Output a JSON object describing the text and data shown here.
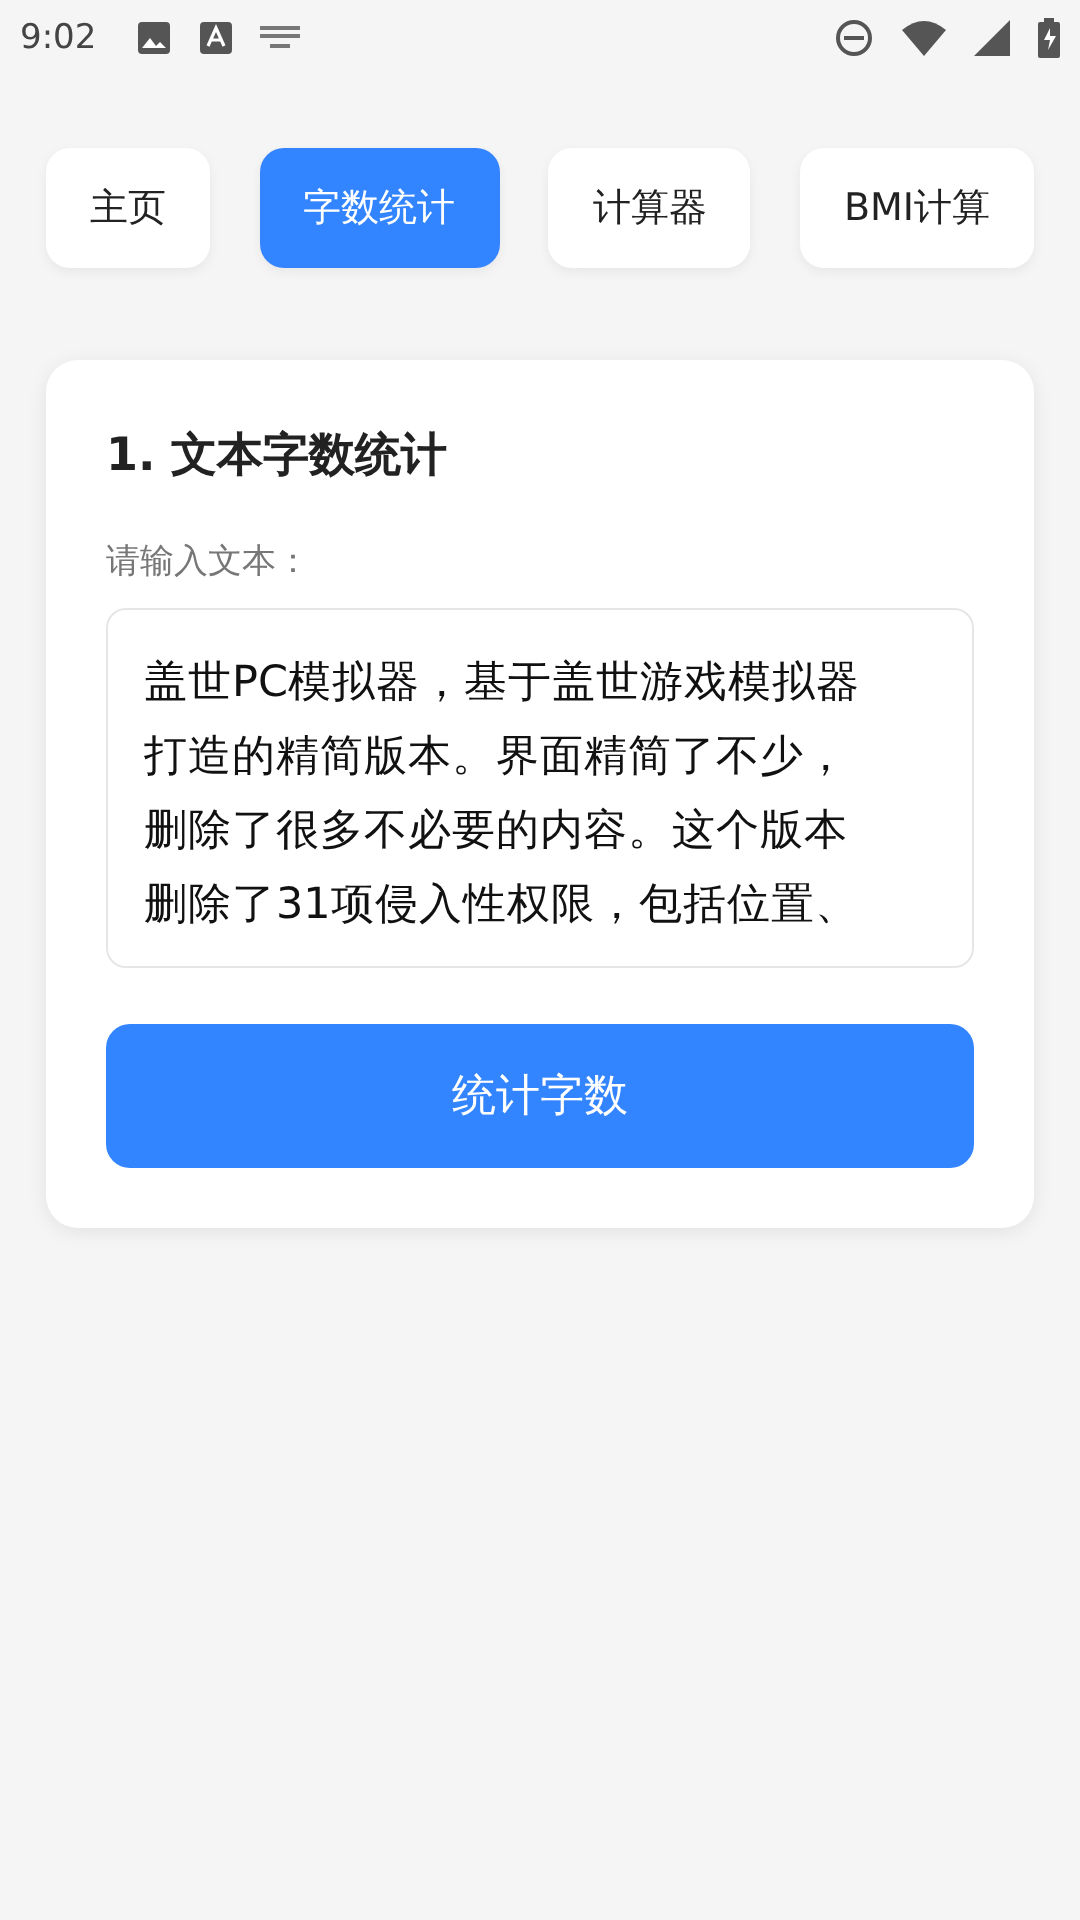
{
  "status_bar": {
    "time": "9:02"
  },
  "tabs": [
    {
      "label": "主页",
      "selected": false
    },
    {
      "label": "字数统计",
      "selected": true
    },
    {
      "label": "计算器",
      "selected": false
    },
    {
      "label": "BMI计算",
      "selected": false
    }
  ],
  "card": {
    "title": "1. 文本字数统计",
    "field_label": "请输入文本：",
    "text_value": "盖世PC模拟器，基于盖世游戏模拟器打造的精简版本。界面精简了不少，删除了很多不必要的内容。这个版本删除了31项侵入性权限，包括位置、",
    "button": "统计字数"
  }
}
